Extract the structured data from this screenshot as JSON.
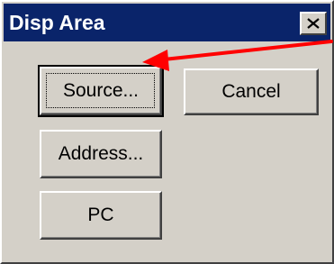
{
  "window": {
    "title": "Disp Area",
    "close_symbol": "x"
  },
  "buttons": {
    "source_label": "Source...",
    "cancel_label": "Cancel",
    "address_label": "Address...",
    "pc_label": "PC"
  },
  "annotation": {
    "icon": "red-arrow-icon",
    "color": "#ff0000"
  },
  "colors": {
    "title_bar": "#0a246a",
    "dialog_face": "#d4d0c8"
  }
}
